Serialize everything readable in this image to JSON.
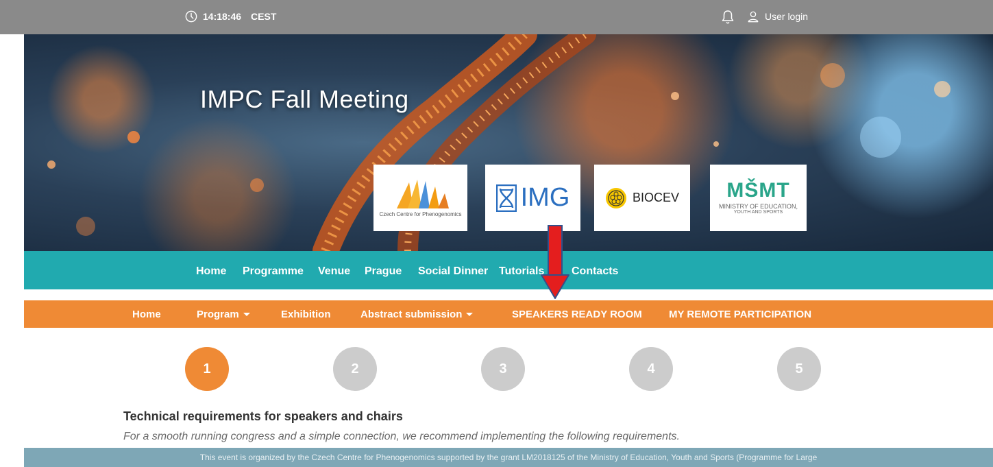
{
  "topbar": {
    "time": "14:18:46",
    "timezone": "CEST",
    "login_label": "User login"
  },
  "hero": {
    "title": "IMPC Fall Meeting",
    "logos": {
      "ccp_caption": "Czech Centre for Phenogenomics",
      "img_text": "IMG",
      "biocev_text": "BIOCEV",
      "msmt_mark": "MŠMT",
      "msmt_line1": "MINISTRY OF EDUCATION,",
      "msmt_line2": "YOUTH AND SPORTS"
    }
  },
  "teal_nav": {
    "items": [
      "Home",
      "Programme",
      "Venue",
      "Prague",
      "Social Dinner",
      "Tutorials",
      "Contacts"
    ]
  },
  "orange_nav": {
    "items": [
      "Home",
      "Program",
      "Exhibition",
      "Abstract submission",
      "SPEAKERS READY ROOM",
      "MY REMOTE PARTICIPATION"
    ]
  },
  "steps": {
    "labels": [
      "1",
      "2",
      "3",
      "4",
      "5"
    ],
    "active": 1
  },
  "content": {
    "title": "Technical requirements for speakers and chairs",
    "text": "For a smooth running congress and a simple connection, we recommend implementing the following requirements."
  },
  "footer": {
    "text": "This event is organized by the Czech Centre for Phenogenomics supported by the grant LM2018125 of the Ministry of Education, Youth and Sports (Programme for Large"
  },
  "colors": {
    "topbar": "#8a8a8a",
    "teal": "#21aaaf",
    "orange": "#ef8a35",
    "step_inactive": "#cccccc",
    "footer": "#7ea7b6",
    "arrow": "#e41e1e"
  },
  "icons": [
    "clock-icon",
    "bell-icon",
    "user-icon",
    "caret-down-icon"
  ]
}
